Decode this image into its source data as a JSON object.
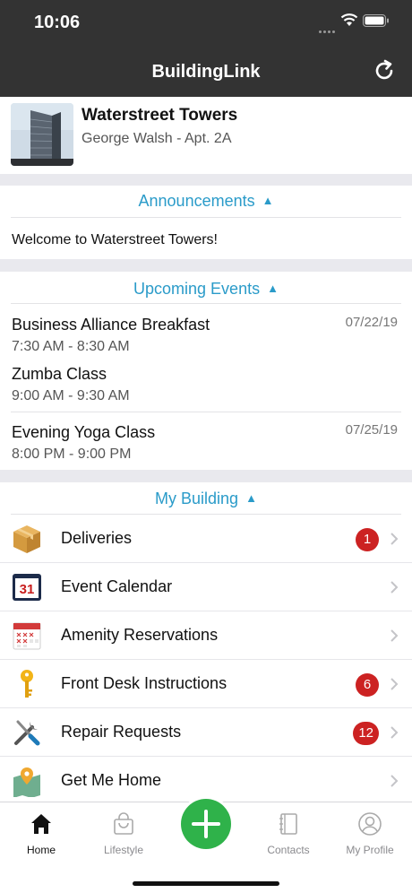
{
  "status_bar": {
    "time": "10:06"
  },
  "nav": {
    "title": "BuildingLink"
  },
  "building": {
    "name": "Waterstreet Towers",
    "resident": "George Walsh - Apt.  2A"
  },
  "announcements": {
    "header": "Announcements",
    "items": [
      "Welcome to Waterstreet Towers!"
    ]
  },
  "events": {
    "header": "Upcoming Events",
    "items": [
      {
        "title": "Business Alliance Breakfast",
        "time": "7:30 AM - 8:30 AM",
        "date": "07/22/19"
      },
      {
        "title": "Zumba Class",
        "time": "9:00 AM - 9:30 AM",
        "date": ""
      },
      {
        "title": "Evening Yoga Class",
        "time": "8:00 PM - 9:00 PM",
        "date": "07/25/19"
      }
    ]
  },
  "my_building": {
    "header": "My Building",
    "items": [
      {
        "label": "Deliveries",
        "icon": "package-icon",
        "badge": "1"
      },
      {
        "label": "Event Calendar",
        "icon": "calendar-icon",
        "icon_text": "31",
        "badge": ""
      },
      {
        "label": "Amenity Reservations",
        "icon": "reservation-calendar-icon",
        "badge": ""
      },
      {
        "label": "Front Desk Instructions",
        "icon": "key-icon",
        "badge": "6"
      },
      {
        "label": "Repair Requests",
        "icon": "tools-icon",
        "badge": "12"
      },
      {
        "label": "Get Me Home",
        "icon": "map-pin-icon",
        "badge": ""
      }
    ]
  },
  "tabs": {
    "home": "Home",
    "lifestyle": "Lifestyle",
    "contacts": "Contacts",
    "profile": "My Profile"
  },
  "colors": {
    "header_bg": "#333333",
    "accent": "#2a9bc9",
    "badge": "#cc2222",
    "add_button": "#2fb24a"
  }
}
